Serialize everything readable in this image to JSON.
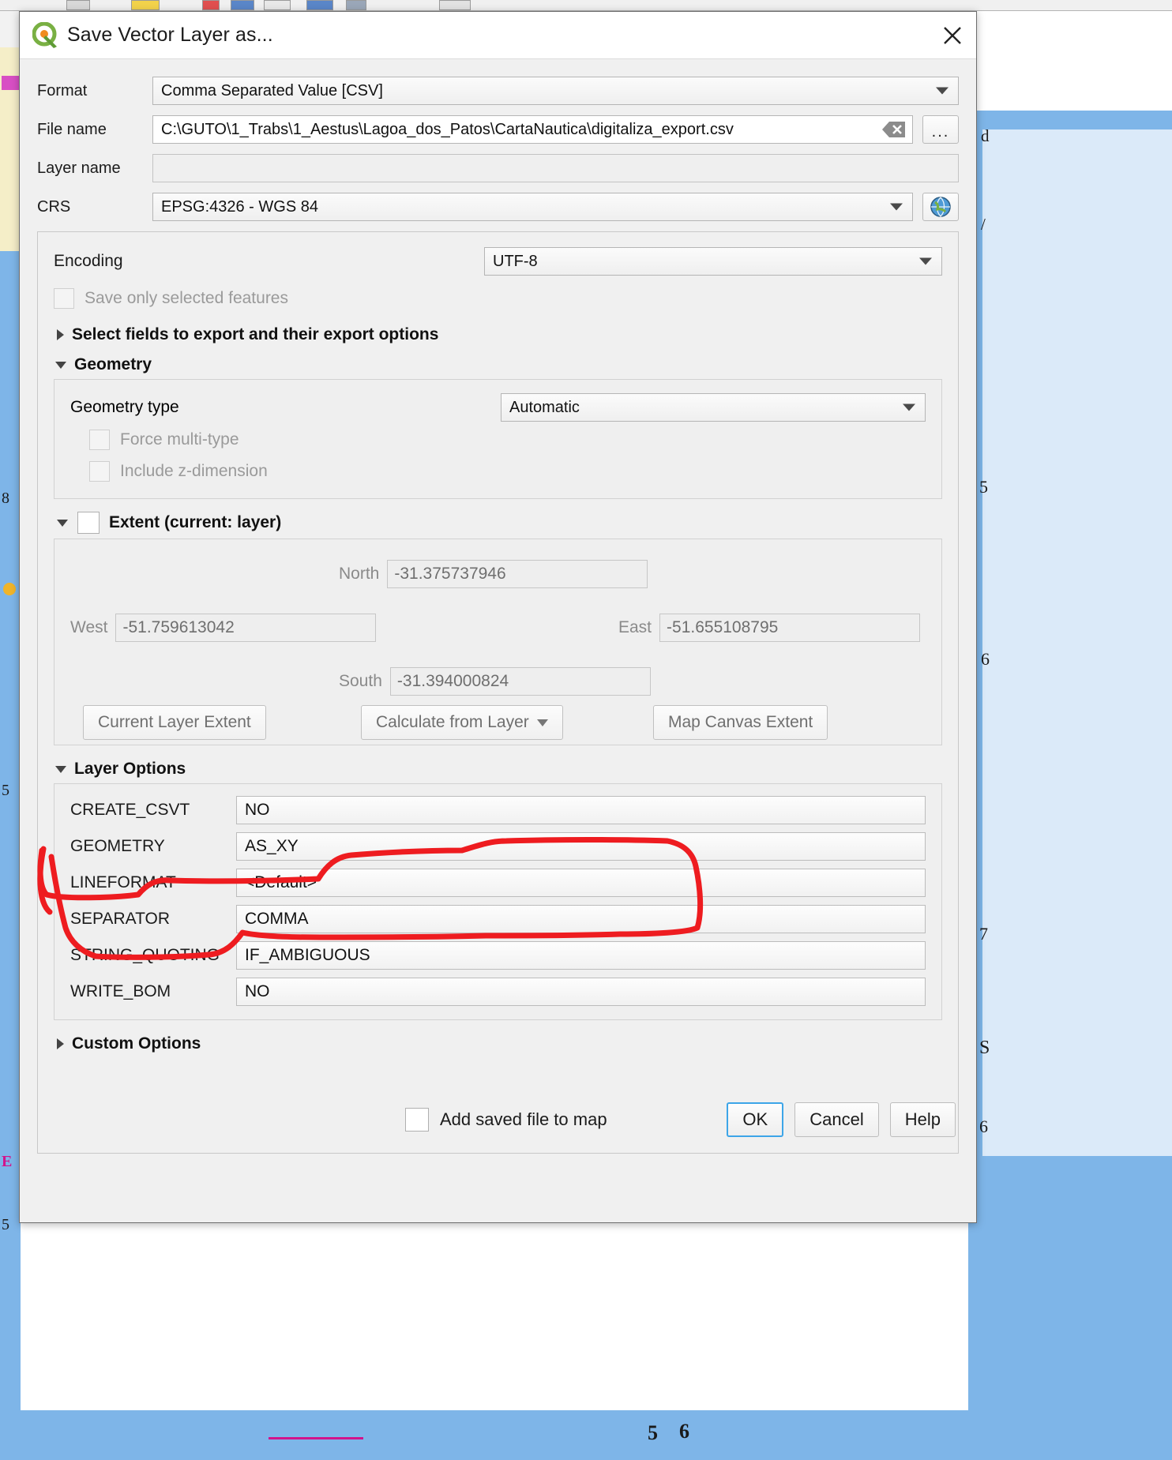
{
  "window": {
    "title": "Save Vector Layer as...",
    "logo_icon": "qgis-logo-icon",
    "close_icon": "close-icon"
  },
  "form": {
    "format": {
      "label": "Format",
      "value": "Comma Separated Value [CSV]"
    },
    "file_name": {
      "label": "File name",
      "value": "C:\\GUTO\\1_Trabs\\1_Aestus\\Lagoa_dos_Patos\\CartaNautica\\digitaliza_export.csv",
      "clear_icon": "clear-icon",
      "browse_label": "..."
    },
    "layer_name": {
      "label": "Layer name",
      "value": "",
      "placeholder": ""
    },
    "crs": {
      "label": "CRS",
      "value": "EPSG:4326 - WGS 84",
      "globe_icon": "globe-icon"
    }
  },
  "encoding": {
    "label": "Encoding",
    "value": "UTF-8"
  },
  "save_selected": {
    "label": "Save only selected features",
    "checked": false,
    "enabled": false
  },
  "select_fields": {
    "label": "Select fields to export and their export options",
    "expanded": false
  },
  "geometry": {
    "label": "Geometry",
    "expanded": true,
    "type": {
      "label": "Geometry type",
      "value": "Automatic"
    },
    "force_multi": {
      "label": "Force multi-type",
      "checked": false,
      "enabled": false
    },
    "include_z": {
      "label": "Include z-dimension",
      "checked": false,
      "enabled": false
    }
  },
  "extent": {
    "label": "Extent (current: layer)",
    "expanded": true,
    "checked": false,
    "north": {
      "label": "North",
      "value": "-31.375737946"
    },
    "west": {
      "label": "West",
      "value": "-51.759613042"
    },
    "east": {
      "label": "East",
      "value": "-51.655108795"
    },
    "south": {
      "label": "South",
      "value": "-31.394000824"
    },
    "buttons": {
      "current_layer_extent": "Current Layer Extent",
      "calculate_from_layer": "Calculate from Layer",
      "map_canvas_extent": "Map Canvas Extent"
    }
  },
  "layer_options": {
    "label": "Layer Options",
    "expanded": true,
    "rows": [
      {
        "name": "CREATE_CSVT",
        "value": "NO"
      },
      {
        "name": "GEOMETRY",
        "value": "AS_XY"
      },
      {
        "name": "LINEFORMAT",
        "value": "<Default>"
      },
      {
        "name": "SEPARATOR",
        "value": "COMMA"
      },
      {
        "name": "STRING_QUOTING",
        "value": "IF_AMBIGUOUS"
      },
      {
        "name": "WRITE_BOM",
        "value": "NO"
      }
    ]
  },
  "custom_options": {
    "label": "Custom Options",
    "expanded": false
  },
  "footer": {
    "add_saved_file": {
      "label": "Add saved file to map",
      "checked": false
    },
    "ok": "OK",
    "cancel": "Cancel",
    "help": "Help"
  },
  "annotation": {
    "color": "#ee1c20",
    "description": "hand-drawn red loop around CREATE_CSVT, GEOMETRY and LINEFORMAT rows"
  }
}
